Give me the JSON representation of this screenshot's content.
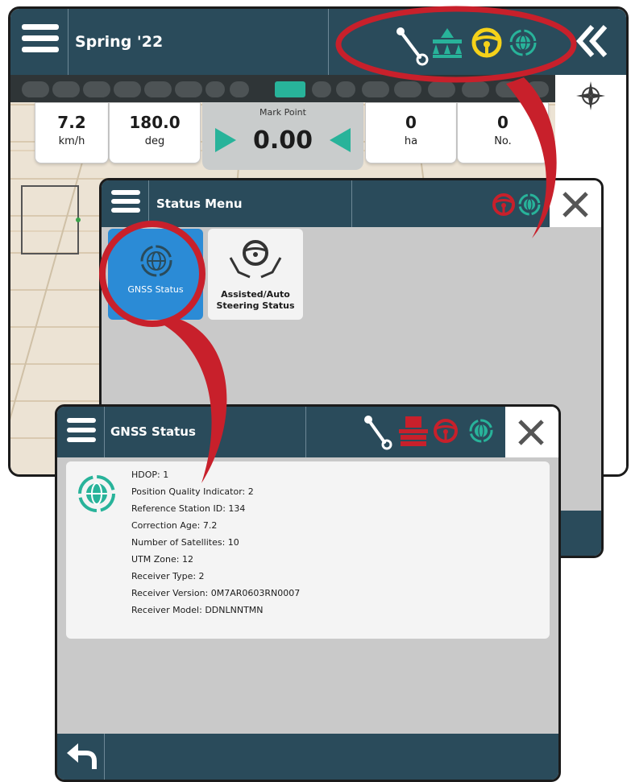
{
  "colors": {
    "bar": "#2a4b5b",
    "accent_green": "#28b39a",
    "highlight_red": "#c8202b",
    "selected_blue": "#2b8bd6",
    "steer_yellow": "#f5d21a"
  },
  "main_screen": {
    "job_title": "Spring '22",
    "status_icons": [
      "boom-icon",
      "sprayer-icon",
      "steering-wheel-icon",
      "gnss-icon"
    ],
    "collapse_icon": "double-chevron-left-icon",
    "compass_icon": "compass-icon",
    "progress_segments": 14,
    "active_segment": 7,
    "stats": [
      {
        "value": "7.2",
        "unit": "km/h"
      },
      {
        "value": "180.0",
        "unit": "deg"
      },
      {
        "value": "0",
        "unit": "ha"
      },
      {
        "value": "0",
        "unit": "No."
      }
    ],
    "mark_point": {
      "label": "Mark Point",
      "value": "0.00"
    }
  },
  "status_menu": {
    "title": "Status Menu",
    "status_icons": [
      "steering-wheel-icon",
      "gnss-icon"
    ],
    "close_icon": "close-icon",
    "tiles": [
      {
        "label": "GNSS Status",
        "icon": "gnss-icon",
        "selected": true
      },
      {
        "label": "Assisted/Auto Steering Status",
        "label_lines": [
          "Assisted/Auto",
          "Steering Status"
        ],
        "icon": "assisted-steering-icon",
        "selected": false
      }
    ]
  },
  "gnss_status": {
    "title": "GNSS Status",
    "status_icons": [
      "boom-icon",
      "sprayer-icon",
      "steering-wheel-icon",
      "gnss-icon"
    ],
    "close_icon": "close-icon",
    "back_icon": "back-arrow-icon",
    "lines": [
      "HDOP: 1",
      "Position Quality Indicator: 2",
      "Reference Station ID: 134",
      "Correction Age: 7.2",
      "Number of Satellites: 10",
      "UTM Zone: 12",
      "Receiver Type: 2",
      "Receiver Version: 0M7AR0603RN0007",
      "Receiver Model: DDNLNNTMN"
    ]
  }
}
